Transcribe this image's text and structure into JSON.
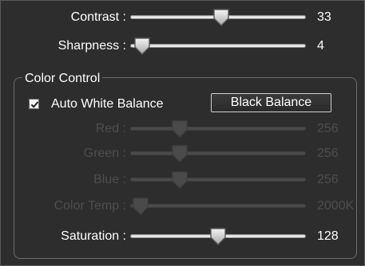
{
  "contrast": {
    "label": "Contrast :",
    "value": "33",
    "fraction": 0.52
  },
  "sharpness": {
    "label": "Sharpness :",
    "value": "4",
    "fraction": 0.07
  },
  "color_control": {
    "title": "Color Control",
    "auto_white_balance": {
      "label": "Auto White Balance",
      "checked": true
    },
    "black_balance_button": "Black Balance",
    "red": {
      "label": "Red :",
      "value": "256",
      "fraction": 0.28,
      "enabled": false
    },
    "green": {
      "label": "Green :",
      "value": "256",
      "fraction": 0.28,
      "enabled": false
    },
    "blue": {
      "label": "Blue :",
      "value": "256",
      "fraction": 0.28,
      "enabled": false
    },
    "color_temp": {
      "label": "Color Temp :",
      "value": "2000K",
      "fraction": 0.06,
      "enabled": false
    },
    "saturation": {
      "label": "Saturation :",
      "value": "128",
      "fraction": 0.5
    }
  },
  "colors": {
    "background": "#2d2d2d",
    "text": "#ffffff",
    "disabled_text": "#4e4e4e"
  }
}
